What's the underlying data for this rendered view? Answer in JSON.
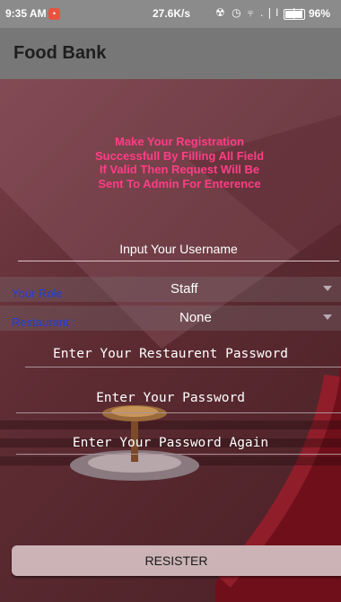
{
  "status_bar": {
    "time": "9:35 AM",
    "notification_badge": "•",
    "net_speed": "27.6K/s",
    "icons": [
      "vibrate-off-icon",
      "alarm-icon",
      "wifi-icon",
      "signal-icon",
      "signal-icon-2",
      "battery-icon"
    ],
    "icons_text": "☢ ◷ ⫧ .❘l .❘l",
    "battery": "96%"
  },
  "app_bar": {
    "title": "Food Bank"
  },
  "form": {
    "message": "Make Your Registration\nSuccessfull By Filling All Field\nIf Valid Then Request Will Be\nSent To Admin For Enterence",
    "username_placeholder": "Input Your Username",
    "role": {
      "label": "Your Role",
      "value": "Staff"
    },
    "restaurant": {
      "label": "Restaurant :",
      "value": "None"
    },
    "restaurant_password_placeholder": "Enter Your Restaurent Password",
    "password_placeholder": "Enter Your Password",
    "password_again_placeholder": "Enter Your Password Again",
    "register_label": "RESISTER"
  },
  "colors": {
    "accent_text": "#ff3d86",
    "label_blue": "#1f3fd9",
    "app_bar": "#777777",
    "button": "#cbb3b6"
  }
}
